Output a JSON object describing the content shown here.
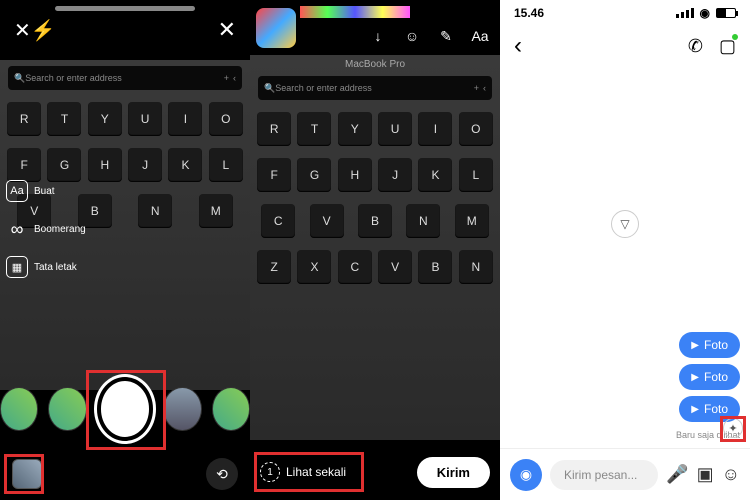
{
  "panel1": {
    "touchbar": {
      "search": "Search or enter address",
      "plus": "+"
    },
    "keys": {
      "row1": [
        "R",
        "T",
        "Y",
        "U",
        "I",
        "O"
      ],
      "row2": [
        "F",
        "G",
        "H",
        "J",
        "K",
        "L"
      ],
      "row3": [
        "V",
        "B",
        "N",
        "M"
      ]
    },
    "modes": {
      "create_icon": "Aa",
      "create": "Buat",
      "boomerang_icon": "∞",
      "boomerang": "Boomerang",
      "layout": "Tata letak"
    }
  },
  "panel2": {
    "mbp": "MacBook Pro",
    "touchbar": {
      "search": "Search or enter address",
      "plus": "+"
    },
    "keys": {
      "row1": [
        "R",
        "T",
        "Y",
        "U",
        "I",
        "O"
      ],
      "row2": [
        "F",
        "G",
        "H",
        "J",
        "K",
        "L"
      ],
      "row3": [
        "C",
        "V",
        "B",
        "N",
        "M"
      ],
      "row4": [
        "Z",
        "X",
        "C",
        "V",
        "B",
        "N"
      ]
    },
    "topicons": {
      "download": "↓",
      "sticker": "☺",
      "draw": "✎",
      "text": "Aa"
    },
    "view_once_num": "1",
    "view_once": "Lihat sekali",
    "send": "Kirim"
  },
  "panel3": {
    "time": "15.46",
    "bubbles": {
      "b1": "Foto",
      "b2": "Foto",
      "b3": "Foto"
    },
    "seen": "Baru saja dilihat",
    "compose": {
      "placeholder": "Kirim pesan..."
    }
  }
}
